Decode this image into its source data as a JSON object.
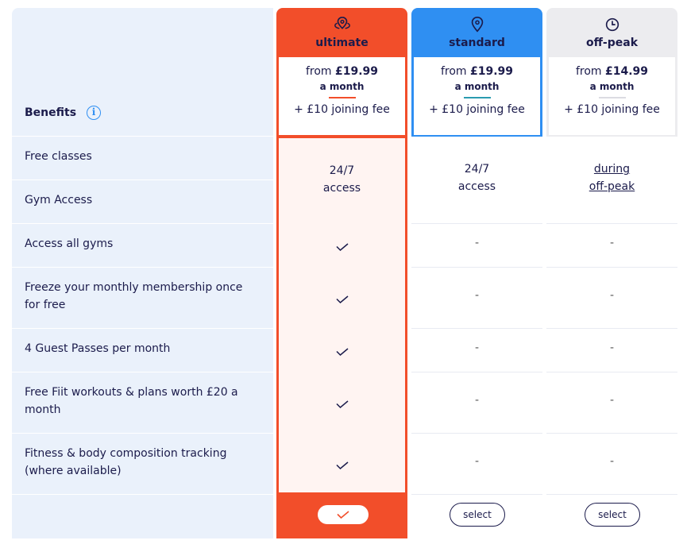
{
  "benefits": {
    "title": "Benefits",
    "info_icon": "info-icon",
    "rows": [
      {
        "label": "Free classes"
      },
      {
        "label": "Gym Access"
      },
      {
        "label": "Access all gyms"
      },
      {
        "label": "Freeze your monthly membership once for free"
      },
      {
        "label": "4 Guest Passes per month"
      },
      {
        "label": "Free Fiit workouts & plans worth £20 a month"
      },
      {
        "label": "Fitness & body composition tracking (where available)"
      }
    ]
  },
  "plans": [
    {
      "id": "ultimate",
      "name": "ultimate",
      "icon": "multi-location-pin-icon",
      "color": "#f24e2a",
      "price_prefix": "from ",
      "price": "£19.99",
      "period": "a month",
      "joining_fee": "+ £10 joining fee",
      "access_line1": "24/7",
      "access_line2": "access",
      "features": [
        "check",
        "check",
        "check",
        "check",
        "check"
      ],
      "selected": true
    },
    {
      "id": "standard",
      "name": "standard",
      "icon": "location-pin-icon",
      "color": "#2f8ff2",
      "price_prefix": "from ",
      "price": "£19.99",
      "period": "a month",
      "joining_fee": "+ £10 joining fee",
      "access_line1": "24/7",
      "access_line2": "access",
      "features": [
        "-",
        "-",
        "-",
        "-",
        "-"
      ],
      "select_label": "select"
    },
    {
      "id": "offpeak",
      "name": "off-peak",
      "icon": "clock-icon",
      "color": "#ececef",
      "price_prefix": "from ",
      "price": "£14.99",
      "period": "a month",
      "joining_fee": "+ £10 joining fee",
      "access_line1": "during",
      "access_line2": "off-peak",
      "features": [
        "-",
        "-",
        "-",
        "-",
        "-"
      ],
      "select_label": "select"
    }
  ]
}
